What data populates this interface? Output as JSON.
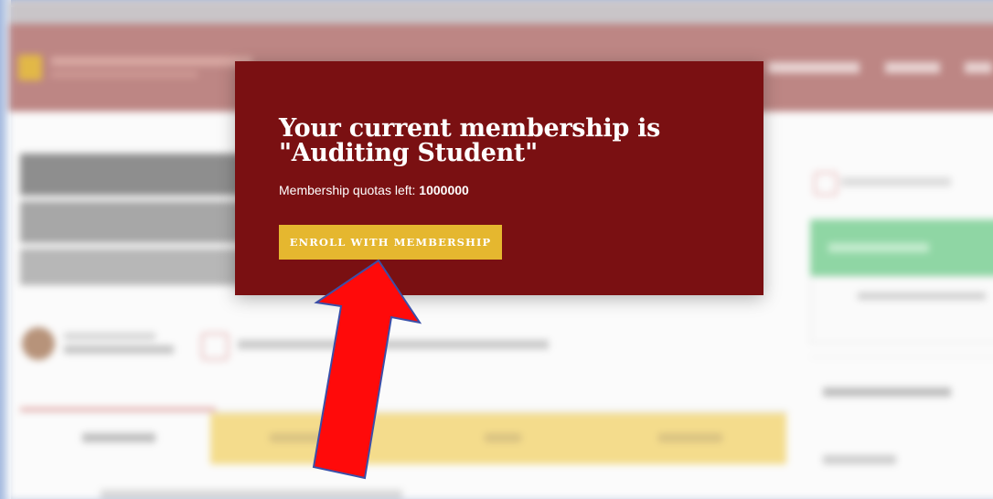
{
  "modal": {
    "title_line1": "Your current membership is",
    "title_line2": "\"Auditing Student\"",
    "quota_label": "Membership quotas left:",
    "quota_value": "1000000",
    "enroll_button": "ENROLL WITH MEMBERSHIP"
  },
  "colors": {
    "modal_background": "#7a1012",
    "button": "#e5b72f",
    "arrow": "#ff0a0a",
    "arrow_outline": "#3a4fa8"
  },
  "annotation": {
    "icon": "red-arrow-icon"
  }
}
